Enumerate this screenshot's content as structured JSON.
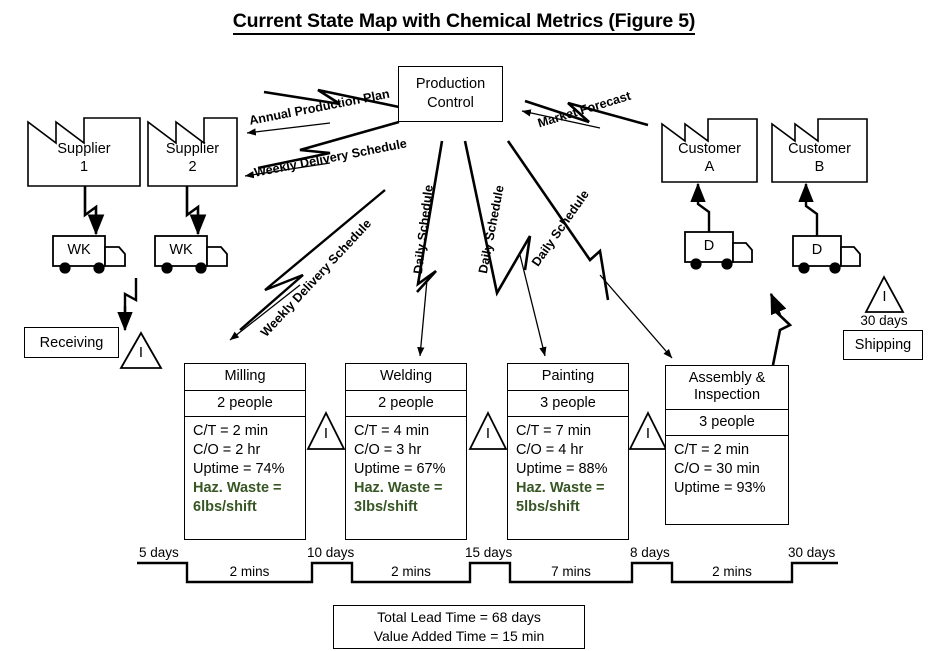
{
  "title": "Current State Map with Chemical Metrics (Figure 5)",
  "production_control": {
    "line1": "Production",
    "line2": "Control"
  },
  "suppliers": [
    {
      "name": "Supplier",
      "id": "1",
      "truck_label": "WK"
    },
    {
      "name": "Supplier",
      "id": "2",
      "truck_label": "WK"
    }
  ],
  "customers": [
    {
      "name": "Customer",
      "id": "A",
      "truck_label": "D"
    },
    {
      "name": "Customer",
      "id": "B",
      "truck_label": "D"
    }
  ],
  "info_flows": {
    "annual_production_plan": "Annual Production Plan",
    "weekly_delivery_schedule_top": "Weekly Delivery Schedule",
    "weekly_delivery_schedule_diag": "Weekly Delivery Schedule",
    "market_forecast": "Market Forecast",
    "daily_schedule_1": "Daily Schedule",
    "daily_schedule_2": "Daily Schedule",
    "daily_schedule_3": "Daily Schedule"
  },
  "receiving": {
    "label": "Receiving"
  },
  "shipping": {
    "label": "Shipping",
    "inventory_days": "30 days"
  },
  "inventory_symbol": "I",
  "processes": [
    {
      "name": "Milling",
      "people": "2 people",
      "ct": "C/T = 2 min",
      "co": "C/O = 2 hr",
      "uptime": "Uptime = 74%",
      "haz_line1": "Haz. Waste =",
      "haz_line2": "6lbs/shift"
    },
    {
      "name": "Welding",
      "people": "2 people",
      "ct": "C/T = 4 min",
      "co": "C/O = 3 hr",
      "uptime": "Uptime = 67%",
      "haz_line1": "Haz. Waste =",
      "haz_line2": "3lbs/shift"
    },
    {
      "name": "Painting",
      "people": "3 people",
      "ct": "C/T = 7 min",
      "co": "C/O = 4 hr",
      "uptime": "Uptime = 88%",
      "haz_line1": "Haz. Waste =",
      "haz_line2": "5lbs/shift"
    },
    {
      "name_line1": "Assembly &",
      "name_line2": "Inspection",
      "people": "3 people",
      "ct": "C/T = 2 min",
      "co": "C/O = 30 min",
      "uptime": "Uptime = 93%"
    }
  ],
  "timeline": {
    "lead_times": [
      "5 days",
      "10 days",
      "15 days",
      "8 days",
      "30 days"
    ],
    "value_times": [
      "2 mins",
      "2 mins",
      "7 mins",
      "2 mins"
    ]
  },
  "summary": {
    "total_lead_time": "Total Lead Time = 68 days",
    "value_added_time": "Value Added Time = 15 min"
  },
  "colors": {
    "haz_waste_green": "#375623",
    "line": "#000000",
    "background": "#ffffff"
  }
}
